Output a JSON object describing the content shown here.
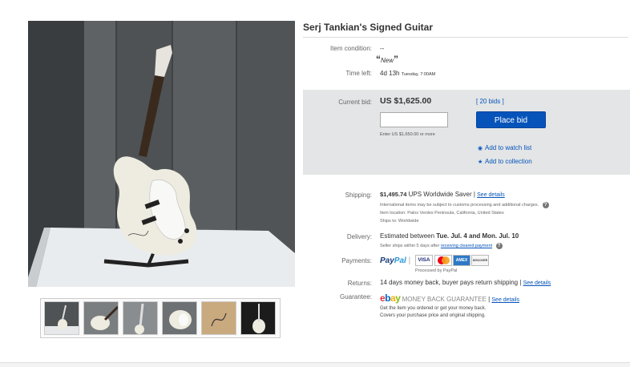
{
  "listing": {
    "title": "Serj Tankian's Signed Guitar"
  },
  "details": {
    "condition_label": "Item condition:",
    "condition_dash": "--",
    "condition_value": "New",
    "time_left_label": "Time left:",
    "time_left_value": "4d 13h",
    "time_left_detail": "Tuesday, 7:00AM"
  },
  "bid": {
    "current_label": "Current bid:",
    "current_value": "US $1,625.00",
    "bids_link": "[ 20 bids ]",
    "input_value": "",
    "hint": "Enter US $1,650.00 or more",
    "place_bid_label": "Place bid",
    "watch_label": "Add to watch list",
    "collection_label": "Add to collection"
  },
  "shipping": {
    "label": "Shipping:",
    "cost": "$1,495.74",
    "service": "UPS Worldwide Saver",
    "see_details": "See details",
    "note": "International items may be subject to customs processing and additional charges.",
    "location": "Item location:  Palos Verdes Peninsula, California, United States",
    "ships_to": "Ships to:  Worldwide"
  },
  "delivery": {
    "label": "Delivery:",
    "prefix": "Estimated between ",
    "range": "Tue. Jul. 4 and Mon. Jul. 10",
    "note_prefix": "Seller ships within 5 days after ",
    "note_link": "receiving cleared payment"
  },
  "payments": {
    "label": "Payments:",
    "paypal_a": "Pay",
    "paypal_b": "Pal",
    "processed": "Processed by PayPal",
    "cards": [
      "VISA",
      "",
      "AMEX",
      "DISCOVER"
    ]
  },
  "returns": {
    "label": "Returns:",
    "value": "14 days money back, buyer pays return shipping",
    "see_details": "See details"
  },
  "guarantee": {
    "label": "Guarantee:",
    "ebay": [
      "e",
      "b",
      "a",
      "y"
    ],
    "mbg": "MONEY BACK GUARANTEE",
    "see_details": "See details",
    "line1": "Get the item you ordered or get your money back.",
    "line2": "Covers your purchase price and original shipping."
  },
  "colors": {
    "link": "#0654ba",
    "place_bid_bg": "#0654ba",
    "bid_box_bg": "#e3e5e6"
  }
}
